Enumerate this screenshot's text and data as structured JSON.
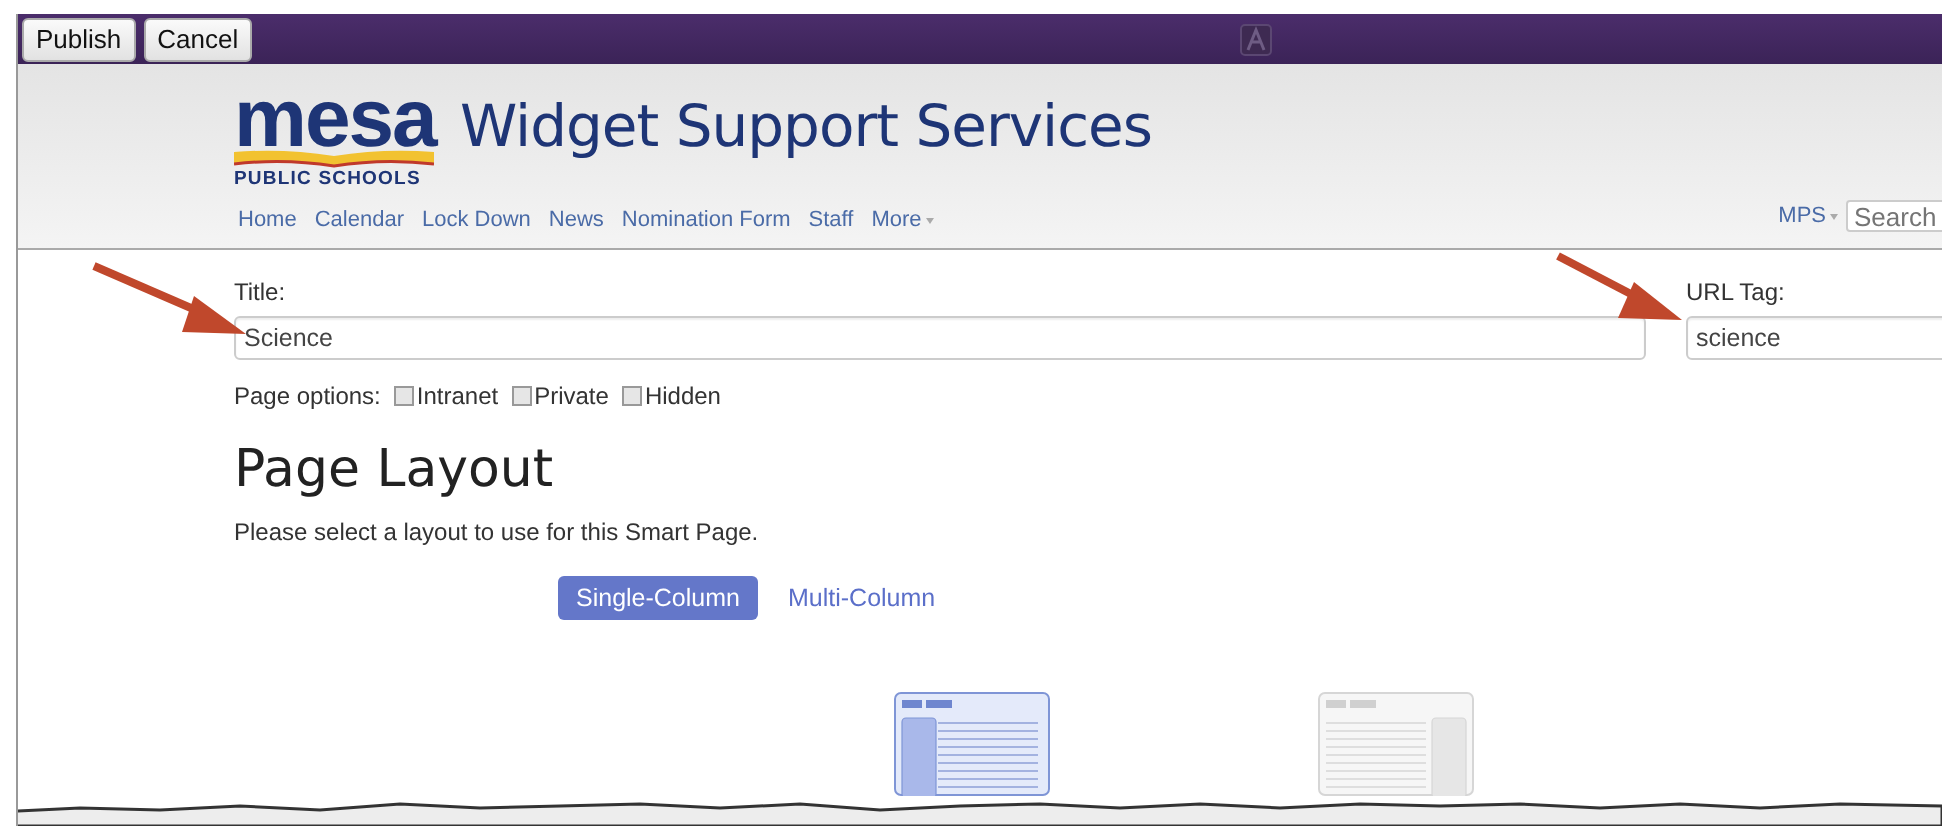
{
  "toolbar": {
    "buttons": [
      "Publish",
      "Cancel"
    ]
  },
  "header": {
    "logo": {
      "word": "mesa",
      "subtitle": "PUBLIC SCHOOLS"
    },
    "site_title": "Widget Support Services",
    "nav": [
      {
        "label": "Home",
        "dropdown": false
      },
      {
        "label": "Calendar",
        "dropdown": false
      },
      {
        "label": "Lock Down",
        "dropdown": false
      },
      {
        "label": "News",
        "dropdown": false
      },
      {
        "label": "Nomination Form",
        "dropdown": false
      },
      {
        "label": "Staff",
        "dropdown": false
      },
      {
        "label": "More",
        "dropdown": true
      }
    ],
    "account_menu": {
      "label": "MPS",
      "dropdown": true
    },
    "search": {
      "placeholder": "Search"
    }
  },
  "form": {
    "title": {
      "label": "Title:",
      "value": "Science"
    },
    "url_tag": {
      "label": "URL Tag:",
      "value": "science"
    },
    "page_options": {
      "label": "Page options:",
      "options": [
        {
          "label": "Intranet",
          "checked": false
        },
        {
          "label": "Private",
          "checked": false
        },
        {
          "label": "Hidden",
          "checked": false
        }
      ]
    }
  },
  "layout": {
    "heading": "Page Layout",
    "description": "Please select a layout to use for this Smart Page.",
    "tabs": [
      {
        "label": "Single-Column",
        "selected": true
      },
      {
        "label": "Multi-Column",
        "selected": false
      }
    ],
    "thumbnails": [
      {
        "kind": "sidebar-left",
        "selected": true
      },
      {
        "kind": "sidebar-right",
        "selected": false
      }
    ]
  }
}
